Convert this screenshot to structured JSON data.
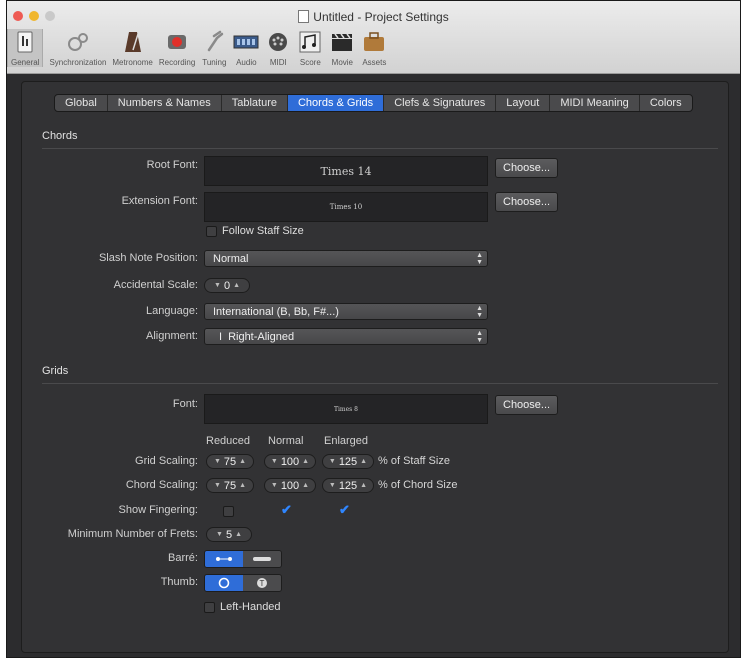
{
  "window": {
    "title": "Untitled - Project Settings"
  },
  "toolbar": {
    "items": [
      {
        "label": "General",
        "icon": "general-icon"
      },
      {
        "label": "Synchronization",
        "icon": "synchronization-icon"
      },
      {
        "label": "Metronome",
        "icon": "metronome-icon"
      },
      {
        "label": "Recording",
        "icon": "record-icon"
      },
      {
        "label": "Tuning",
        "icon": "tuning-fork-icon"
      },
      {
        "label": "Audio",
        "icon": "audio-icon"
      },
      {
        "label": "MIDI",
        "icon": "midi-icon"
      },
      {
        "label": "Score",
        "icon": "score-icon"
      },
      {
        "label": "Movie",
        "icon": "movie-icon"
      },
      {
        "label": "Assets",
        "icon": "assets-icon"
      }
    ]
  },
  "tabs": [
    "Global",
    "Numbers & Names",
    "Tablature",
    "Chords & Grids",
    "Clefs & Signatures",
    "Layout",
    "MIDI Meaning",
    "Colors"
  ],
  "active_tab": "Chords & Grids",
  "chords": {
    "section_title": "Chords",
    "root_font": {
      "label": "Root Font:",
      "value": "Times 14",
      "button": "Choose..."
    },
    "extension_font": {
      "label": "Extension Font:",
      "value": "Times 10",
      "button": "Choose..."
    },
    "follow_staff_size": {
      "label": "Follow Staff Size",
      "checked": false
    },
    "slash_note_position": {
      "label": "Slash Note Position:",
      "value": "Normal"
    },
    "accidental_scale": {
      "label": "Accidental Scale:",
      "value": "0"
    },
    "language": {
      "label": "Language:",
      "value": "International (B, Bb, F#...)"
    },
    "alignment": {
      "label": "Alignment:",
      "value": "Right-Aligned",
      "prefix": "I"
    }
  },
  "grids": {
    "section_title": "Grids",
    "font": {
      "label": "Font:",
      "value": "Times 8",
      "button": "Choose..."
    },
    "columns": [
      "Reduced",
      "Normal",
      "Enlarged"
    ],
    "grid_scaling": {
      "label": "Grid Scaling:",
      "values": [
        "75",
        "100",
        "125"
      ],
      "suffix": "% of Staff Size"
    },
    "chord_scaling": {
      "label": "Chord Scaling:",
      "values": [
        "75",
        "100",
        "125"
      ],
      "suffix": "% of Chord Size"
    },
    "show_fingering": {
      "label": "Show Fingering:",
      "checked": [
        false,
        true,
        true
      ]
    },
    "min_frets": {
      "label": "Minimum Number of Frets:",
      "value": "5"
    },
    "barre": {
      "label": "Barré:",
      "selected": 0
    },
    "thumb": {
      "label": "Thumb:",
      "selected": 0
    },
    "left_handed": {
      "label": "Left-Handed",
      "checked": false
    }
  },
  "colors": {
    "accent": "#2f6dd8",
    "checkmark": "#2f86ff",
    "panel": "#323234"
  }
}
